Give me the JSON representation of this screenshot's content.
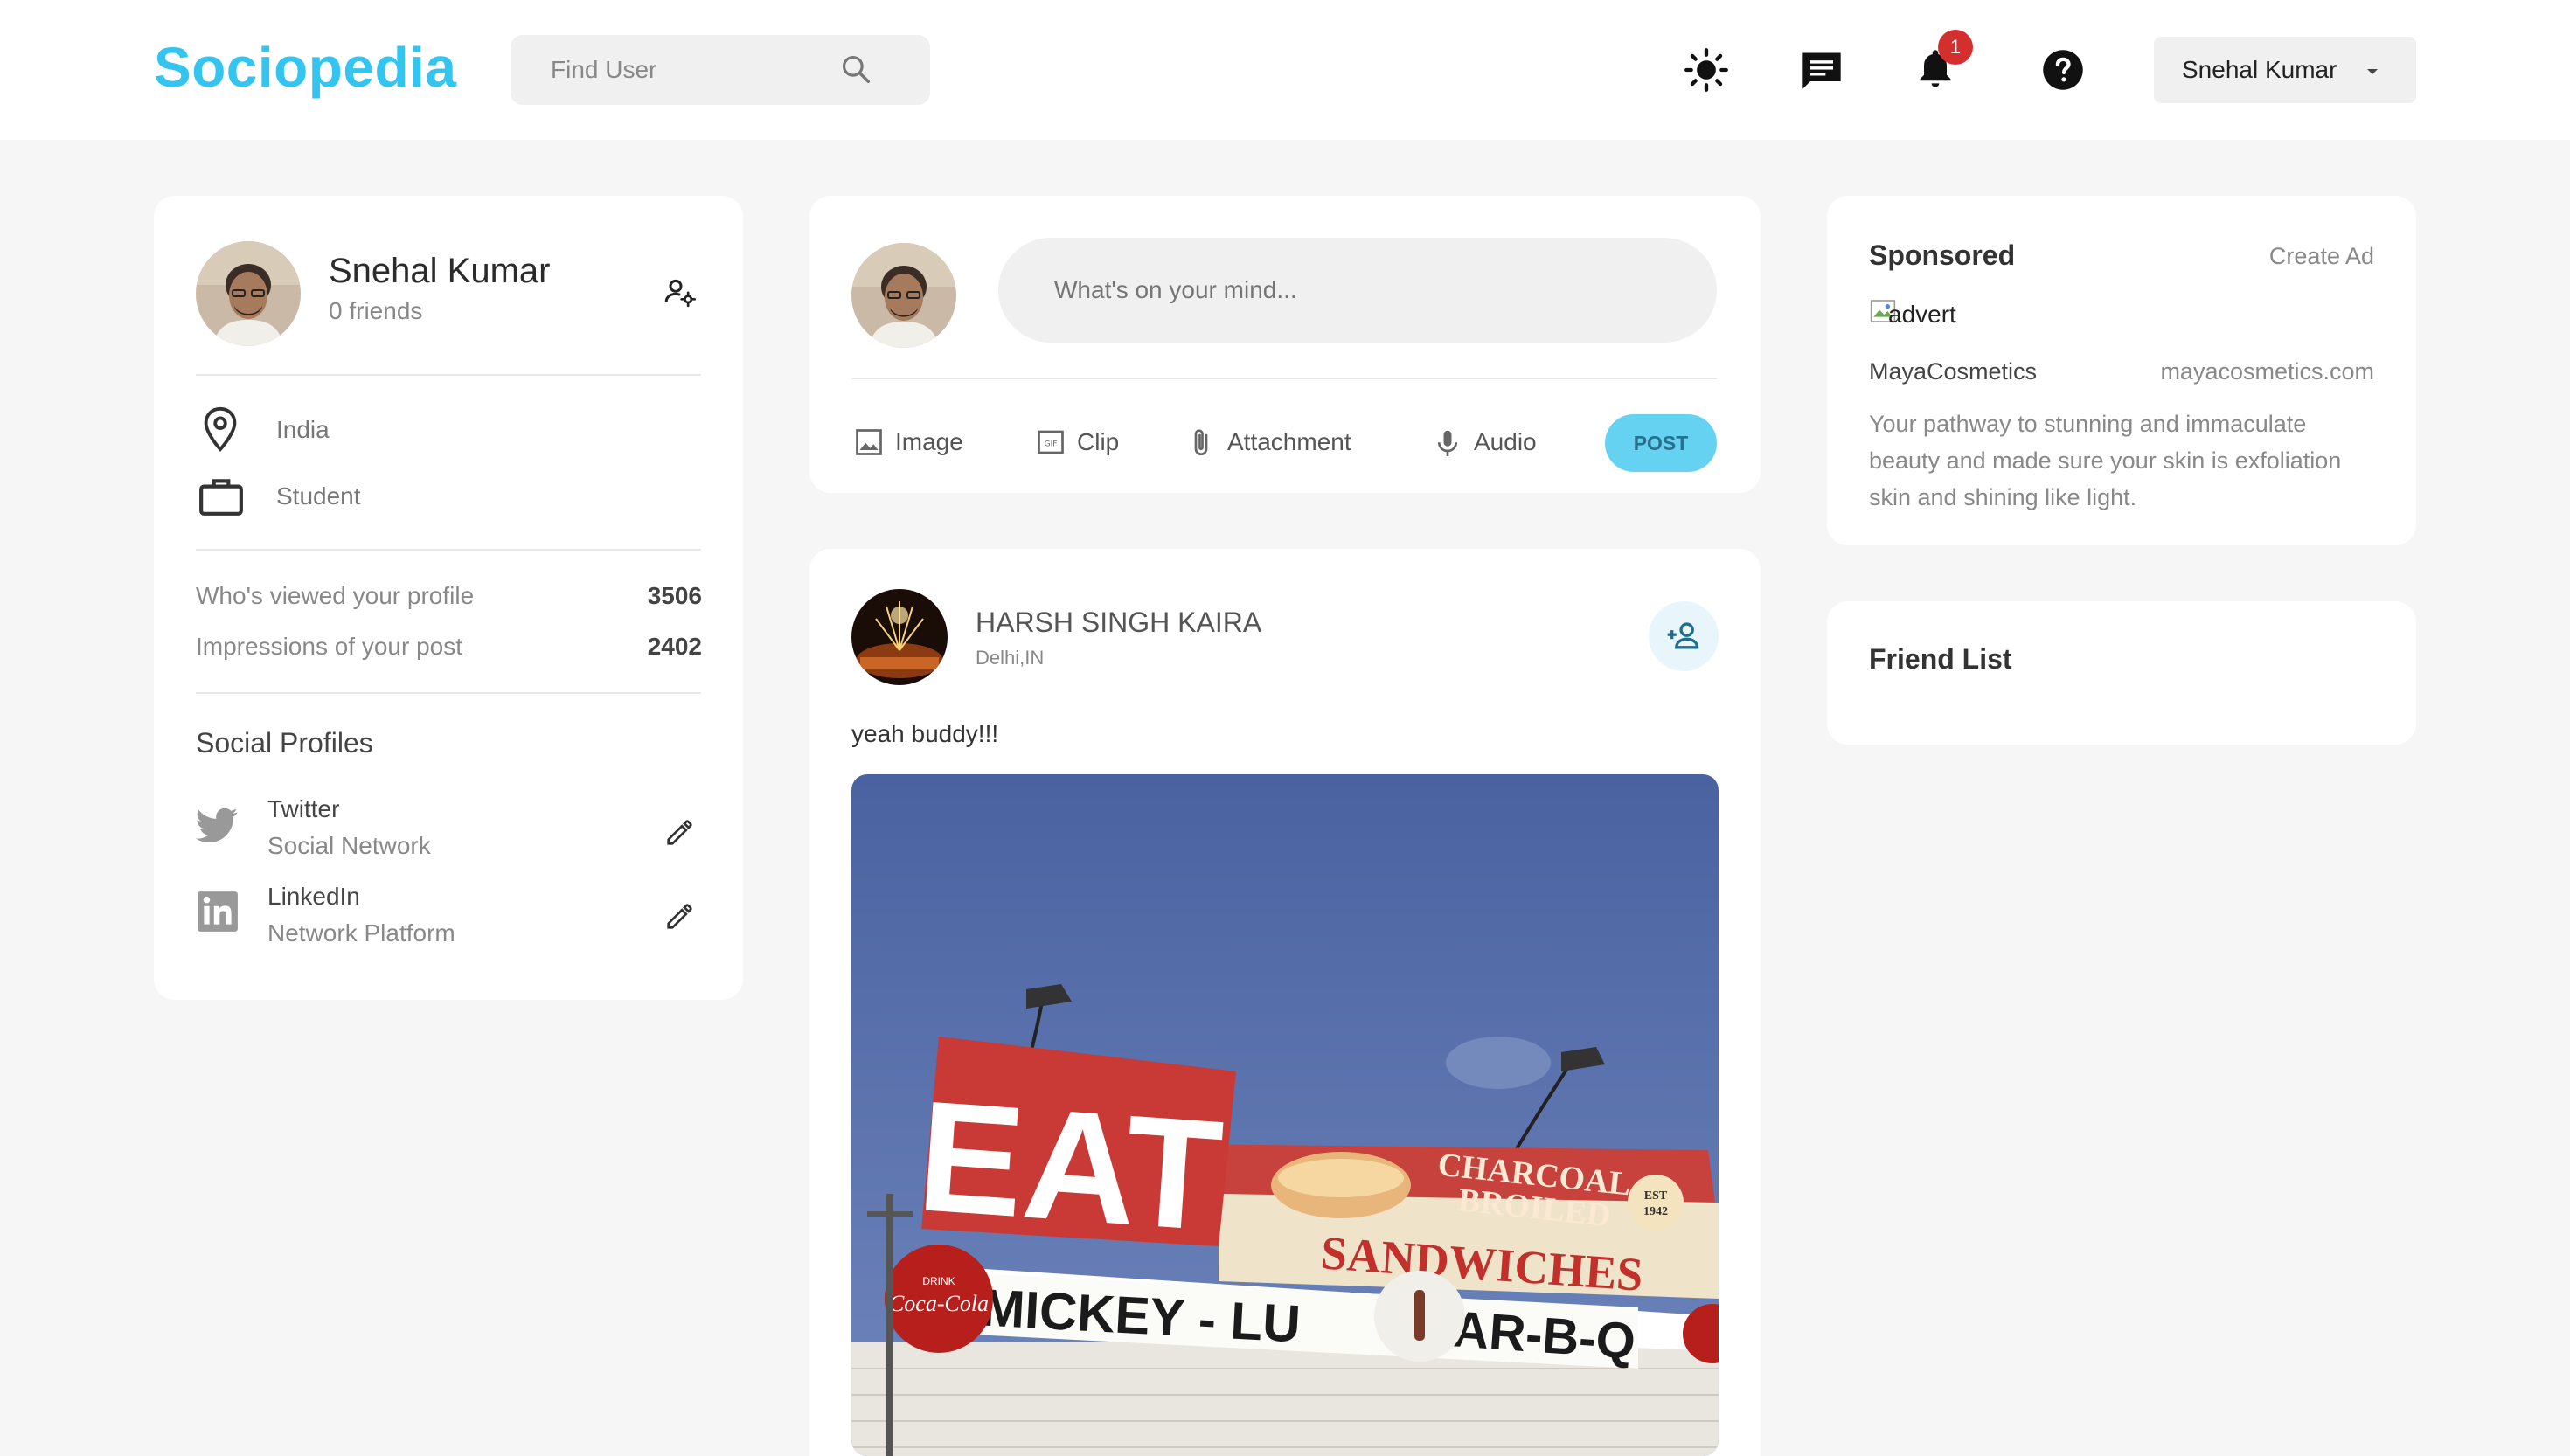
{
  "navbar": {
    "logo": "Sociopedia",
    "search_placeholder": "Find User",
    "notification_count": "1",
    "user_name": "Snehal Kumar"
  },
  "profile": {
    "name": "Snehal Kumar",
    "friends": "0 friends",
    "location": "India",
    "occupation": "Student",
    "stats": [
      {
        "label": "Who's viewed your profile",
        "value": "3506"
      },
      {
        "label": "Impressions of your post",
        "value": "2402"
      }
    ],
    "social_title": "Social Profiles",
    "socials": [
      {
        "name": "Twitter",
        "sub": "Social Network",
        "icon": "twitter-icon"
      },
      {
        "name": "LinkedIn",
        "sub": "Network Platform",
        "icon": "linkedin-icon"
      }
    ]
  },
  "composer": {
    "placeholder": "What's on your mind...",
    "actions": [
      "Image",
      "Clip",
      "Attachment",
      "Audio"
    ],
    "post_label": "POST"
  },
  "post": {
    "author": "HARSH SINGH KAIRA",
    "location": "Delhi,IN",
    "text": "yeah buddy!!!",
    "image_signs": {
      "eat": "EAT",
      "charcoal": "CHARCOAL",
      "broiled": "BROILED",
      "sandwiches": "SANDWICHES",
      "mickey": "MICKEY - LU",
      "bbq": "BAR-B-Q",
      "drink": "DRINK",
      "coke": "Coca-Cola",
      "est": "EST",
      "year": "1942"
    }
  },
  "sponsored": {
    "title": "Sponsored",
    "create_ad": "Create Ad",
    "image_alt": "advert",
    "brand": "MayaCosmetics",
    "url": "mayacosmetics.com",
    "description_lines": [
      "Your pathway to stunning and immaculate",
      "beauty and made sure your skin is exfoliation",
      "skin and shining like light."
    ]
  },
  "friends": {
    "title": "Friend List"
  },
  "colors": {
    "brand": "#33c5f0",
    "post_button": "#66d2f2",
    "badge": "#d32f2f",
    "background": "#f6f6f6"
  }
}
